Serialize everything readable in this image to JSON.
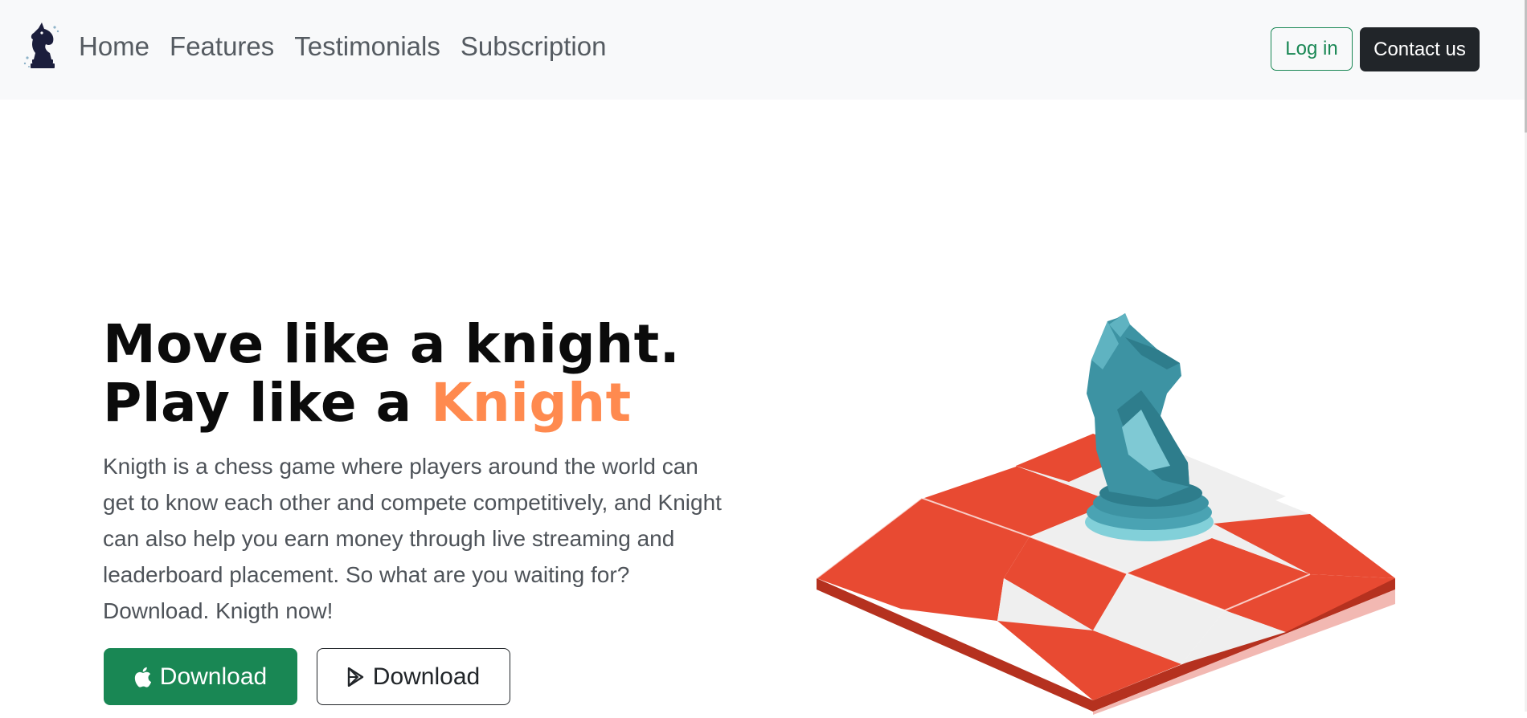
{
  "nav": {
    "logo_icon": "knight-logo-icon",
    "links": [
      "Home",
      "Features",
      "Testimonials",
      "Subscription"
    ],
    "login_label": "Log in",
    "contact_label": "Contact us"
  },
  "hero": {
    "title_line1": "Move like a knight.",
    "title_line2_prefix": "Play like a ",
    "title_line2_accent": "Knight",
    "description": "Knigth is a chess game where players around the world can get to know each other and compete competitively, and Knight can also help you earn money through live streaming and leaderboard placement. So what are you waiting for? Download. Knigth now!",
    "download_apple_label": "Download",
    "download_apple_icon": "apple-icon",
    "download_play_label": "Download",
    "download_play_icon": "google-play-icon",
    "illustration": "chess-knight-on-board-illustration"
  },
  "colors": {
    "accent": "#ff8a4f",
    "success": "#198754",
    "dark": "#212529",
    "board_red": "#e84a32",
    "board_light": "#efefef",
    "knight": "#3d93a3"
  }
}
